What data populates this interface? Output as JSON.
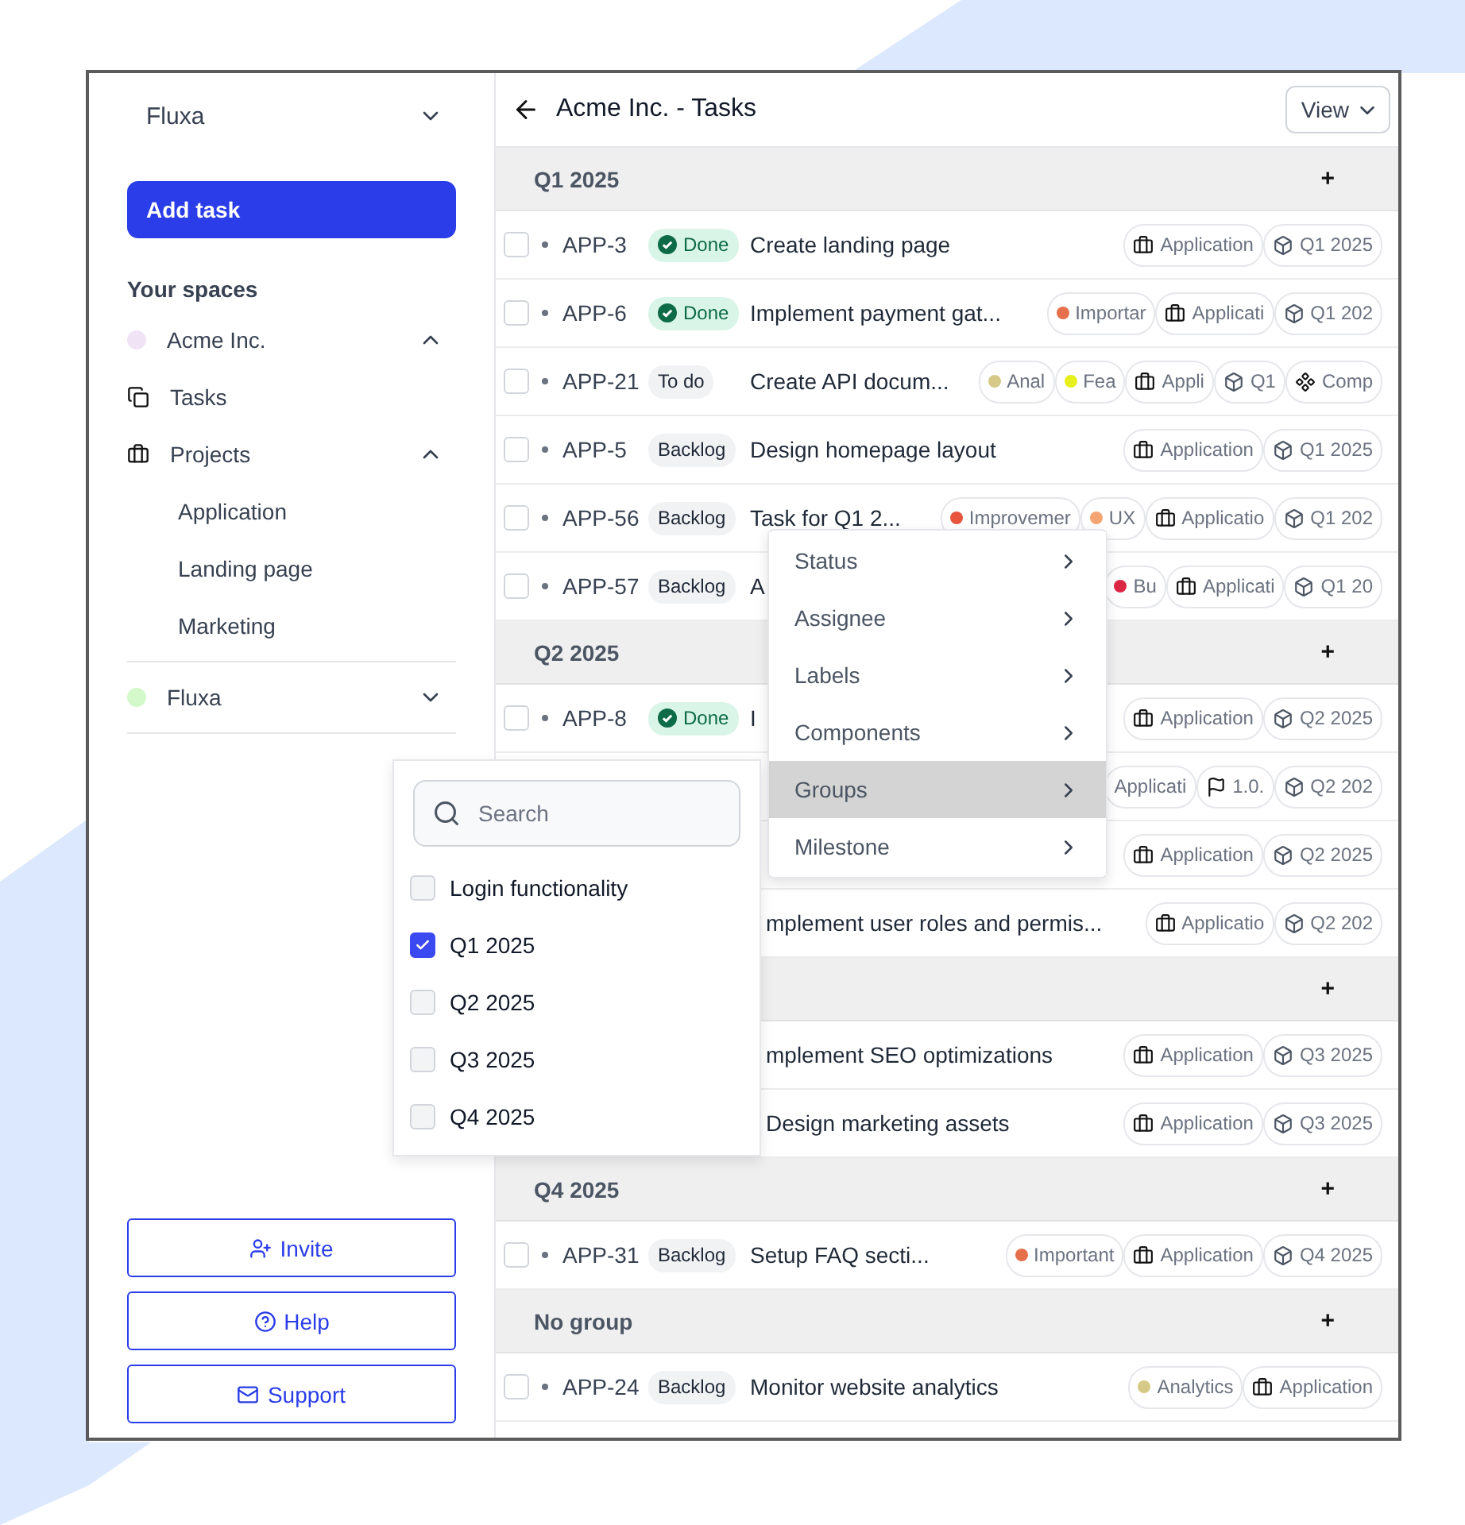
{
  "sidebar": {
    "workspace": "Fluxa",
    "add_button": "Add task",
    "section_title": "Your spaces",
    "spaces": [
      {
        "name": "Acme Inc.",
        "color": "#f1e3f6",
        "expanded": true,
        "children": [
          {
            "name": "Tasks",
            "kind": "tasks"
          },
          {
            "name": "Projects",
            "kind": "projects",
            "expanded": true,
            "children": [
              {
                "name": "Application"
              },
              {
                "name": "Landing page"
              },
              {
                "name": "Marketing"
              }
            ]
          }
        ]
      },
      {
        "name": "Fluxa",
        "color": "#d3f8c9",
        "expanded": false
      }
    ],
    "footer_buttons": [
      {
        "label": "Invite",
        "kind": "invite"
      },
      {
        "label": "Help",
        "kind": "help"
      },
      {
        "label": "Support",
        "kind": "support"
      }
    ]
  },
  "header": {
    "title": "Acme Inc. - Tasks",
    "view_button": "View"
  },
  "groups": [
    {
      "label": "Q1 2025",
      "add": "+",
      "rows": [
        {
          "checked": false,
          "id": "APP-3",
          "status": {
            "label": "Done",
            "kind": "done"
          },
          "title": "Create landing page",
          "tags": [
            {
              "kind": "project",
              "text": "Application"
            },
            {
              "kind": "milestone",
              "text": "Q1 2025"
            }
          ]
        },
        {
          "checked": false,
          "id": "APP-6",
          "status": {
            "label": "Done",
            "kind": "done"
          },
          "title": "Implement payment gat...",
          "tags": [
            {
              "kind": "label",
              "text": "Importar",
              "color": "#e5704b"
            },
            {
              "kind": "project",
              "text": "Applicati"
            },
            {
              "kind": "milestone",
              "text": "Q1 202"
            }
          ]
        },
        {
          "checked": false,
          "id": "APP-21",
          "status": {
            "label": "To do",
            "kind": "todo"
          },
          "title": "Create API docum...",
          "tags": [
            {
              "kind": "label",
              "text": "Anal",
              "color": "#d6c987"
            },
            {
              "kind": "label",
              "text": "Fea",
              "color": "#e6f01a"
            },
            {
              "kind": "project",
              "text": "Appli"
            },
            {
              "kind": "milestone",
              "text": "Q1"
            },
            {
              "kind": "component",
              "text": "Comp"
            }
          ]
        },
        {
          "checked": false,
          "id": "APP-5",
          "status": {
            "label": "Backlog",
            "kind": "backlog"
          },
          "title": "Design homepage layout",
          "tags": [
            {
              "kind": "project",
              "text": "Application"
            },
            {
              "kind": "milestone",
              "text": "Q1 2025"
            }
          ]
        },
        {
          "checked": false,
          "id": "APP-56",
          "status": {
            "label": "Backlog",
            "kind": "backlog"
          },
          "title": "Task for Q1 2...",
          "tags": [
            {
              "kind": "label",
              "text": "Improvemer",
              "color": "#e8553f"
            },
            {
              "kind": "label",
              "text": "UX",
              "color": "#f5a572"
            },
            {
              "kind": "project",
              "text": "Applicatio"
            },
            {
              "kind": "milestone",
              "text": "Q1 202"
            }
          ]
        },
        {
          "checked": false,
          "id": "APP-57",
          "status": {
            "label": "Backlog",
            "kind": "backlog"
          },
          "title": "A",
          "tags": [
            {
              "kind": "label",
              "text": "Bu",
              "color": "#dc2743"
            },
            {
              "kind": "project",
              "text": "Applicati"
            },
            {
              "kind": "milestone",
              "text": "Q1 20"
            }
          ]
        }
      ]
    },
    {
      "label": "Q2 2025",
      "add": "+",
      "rows": [
        {
          "checked": false,
          "id": "APP-8",
          "status": {
            "label": "Done",
            "kind": "done"
          },
          "title": "I",
          "tags": [
            {
              "kind": "project",
              "text": "Application"
            },
            {
              "kind": "milestone",
              "text": "Q2 2025"
            }
          ]
        },
        {
          "tags": [
            {
              "kind": "plain",
              "text": "Applicati"
            },
            {
              "kind": "version",
              "text": "1.0."
            },
            {
              "kind": "milestone",
              "text": "Q2 202"
            }
          ]
        },
        {
          "tags": [
            {
              "kind": "project",
              "text": "Application"
            },
            {
              "kind": "milestone",
              "text": "Q2 2025"
            }
          ]
        },
        {
          "title": "mplement user roles and permis...",
          "tags": [
            {
              "kind": "project",
              "text": "Applicatio"
            },
            {
              "kind": "milestone",
              "text": "Q2 202"
            }
          ]
        }
      ]
    },
    {
      "add": "+",
      "rows": [
        {
          "title": "mplement SEO optimizations",
          "tags": [
            {
              "kind": "project",
              "text": "Application"
            },
            {
              "kind": "milestone",
              "text": "Q3 2025"
            }
          ]
        },
        {
          "title": "Design marketing assets",
          "tags": [
            {
              "kind": "project",
              "text": "Application"
            },
            {
              "kind": "milestone",
              "text": "Q3 2025"
            }
          ]
        }
      ]
    },
    {
      "label": "Q4 2025",
      "add": "+",
      "rows": [
        {
          "checked": false,
          "id": "APP-31",
          "status": {
            "label": "Backlog",
            "kind": "backlog"
          },
          "title": "Setup FAQ secti...",
          "tags": [
            {
              "kind": "label",
              "text": "Important",
              "color": "#e5704b"
            },
            {
              "kind": "project",
              "text": "Application"
            },
            {
              "kind": "milestone",
              "text": "Q4 2025"
            }
          ]
        }
      ]
    },
    {
      "label": "No group",
      "add": "+",
      "rows": [
        {
          "checked": false,
          "id": "APP-24",
          "status": {
            "label": "Backlog",
            "kind": "backlog"
          },
          "title": "Monitor website analytics",
          "tags": [
            {
              "kind": "label",
              "text": "Analytics",
              "color": "#d6c987"
            },
            {
              "kind": "project",
              "text": "Application"
            }
          ]
        }
      ]
    }
  ],
  "context_menu": [
    {
      "label": "Status",
      "selected": false
    },
    {
      "label": "Assignee",
      "selected": false
    },
    {
      "label": "Labels",
      "selected": false
    },
    {
      "label": "Components",
      "selected": false
    },
    {
      "label": "Groups",
      "selected": true
    },
    {
      "label": "Milestone",
      "selected": false
    }
  ],
  "groups_popover": {
    "search": {
      "placeholder": "Search"
    },
    "options": [
      {
        "label": "Login functionality",
        "checked": false
      },
      {
        "label": "Q1 2025",
        "checked": true
      },
      {
        "label": "Q2 2025",
        "checked": false
      },
      {
        "label": "Q3 2025",
        "checked": false
      },
      {
        "label": "Q4 2025",
        "checked": false
      }
    ]
  }
}
